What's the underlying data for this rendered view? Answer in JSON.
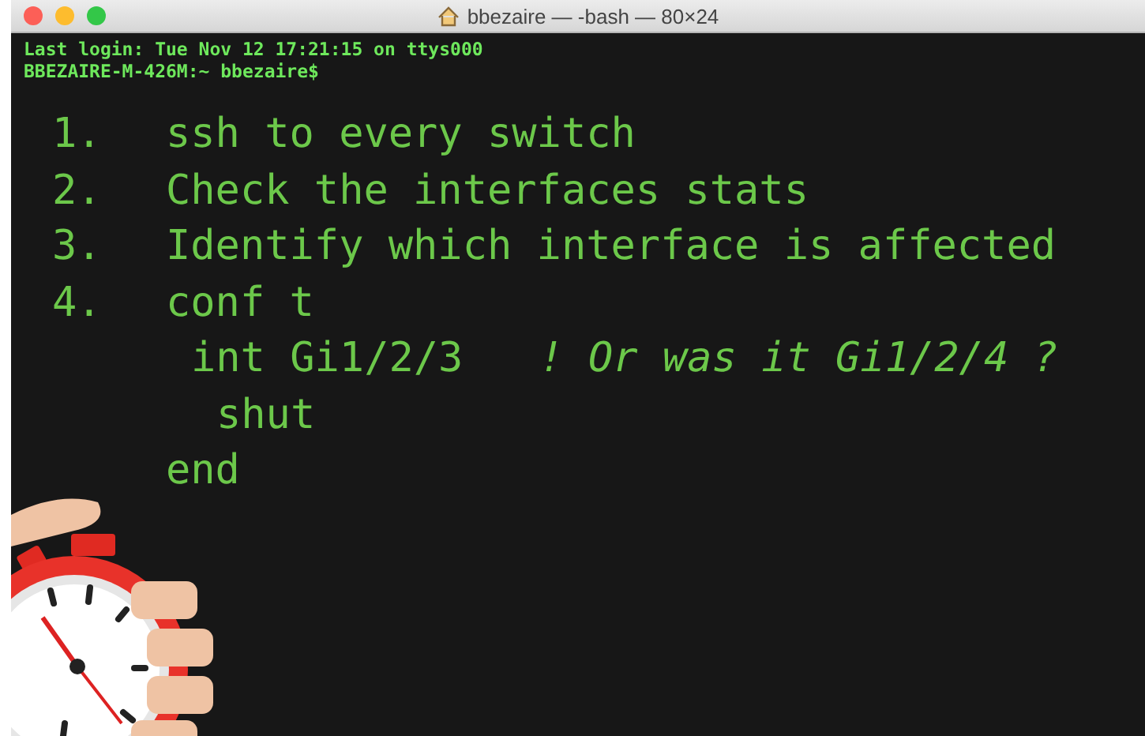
{
  "window": {
    "title": "bbezaire — -bash — 80×24"
  },
  "terminal": {
    "lines": [
      "Last login: Tue Nov 12 17:21:15 on ttys000",
      "BBEZAIRE-M-426M:~ bbezaire$"
    ]
  },
  "steps": [
    {
      "number": "1.",
      "text": "ssh to every switch"
    },
    {
      "number": "2.",
      "text": "Check the interfaces stats"
    },
    {
      "number": "3.",
      "text": "Identify which interface is affected"
    },
    {
      "number": "4.",
      "text": "conf t",
      "children": [
        {
          "text": "int Gi1/2/3",
          "comment": "! Or was it Gi1/2/4 ?",
          "children": [
            {
              "text": "shut"
            }
          ]
        }
      ]
    },
    {
      "text": "end"
    }
  ]
}
